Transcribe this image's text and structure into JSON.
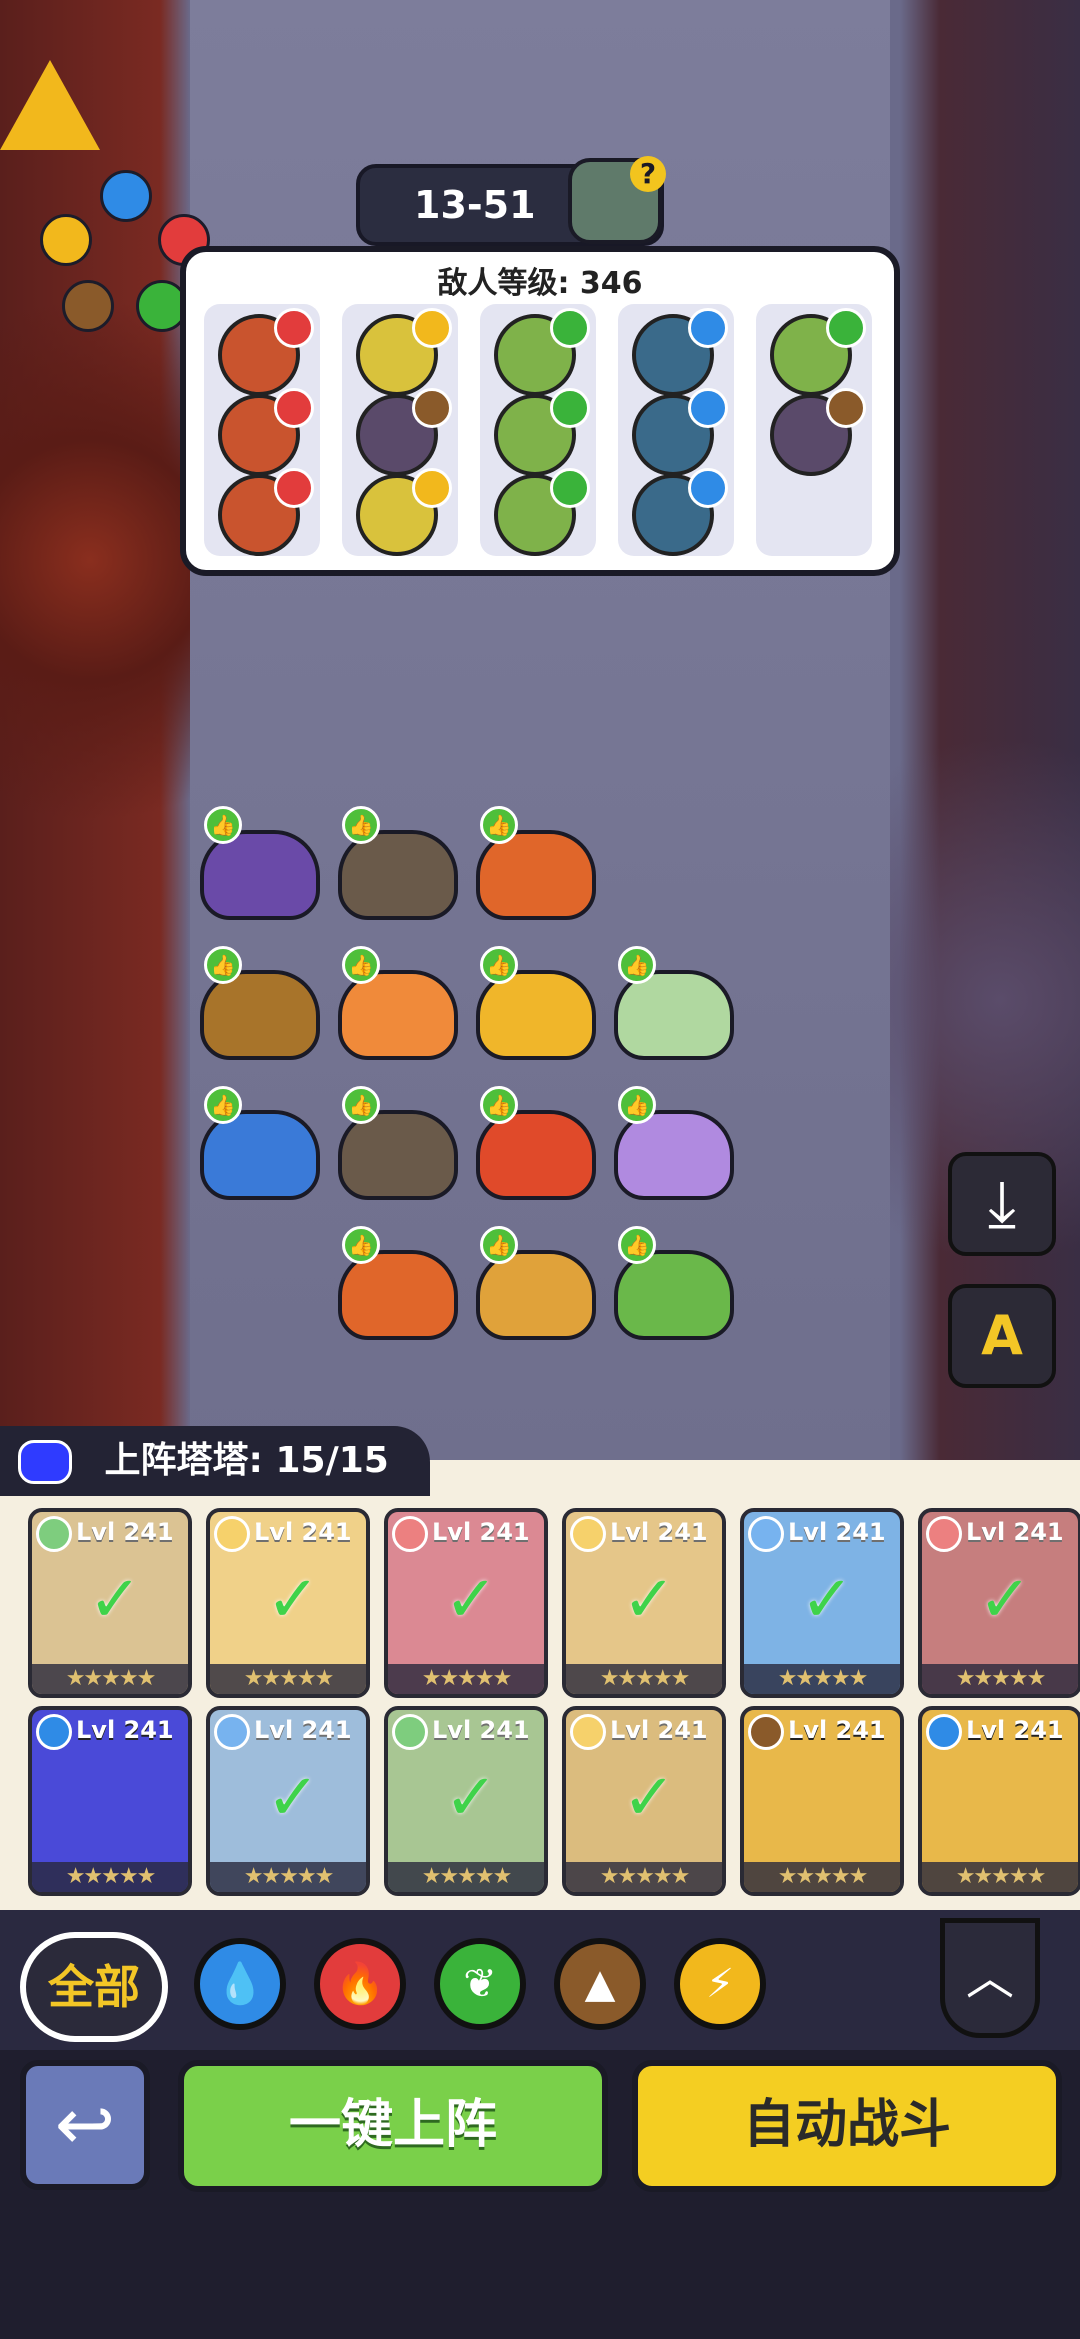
{
  "stage": {
    "label": "13-51"
  },
  "enemy_panel": {
    "title": "敌人等级: 346",
    "columns": [
      [
        "fire",
        "fire",
        "fire"
      ],
      [
        "light",
        "earth",
        "light"
      ],
      [
        "leaf",
        "leaf",
        "leaf"
      ],
      [
        "water",
        "water",
        "water"
      ],
      [
        "leaf",
        "earth"
      ]
    ]
  },
  "roster": {
    "title": "上阵塔塔: 15/15",
    "level_label": "Lvl 241",
    "stars": "★★★★★"
  },
  "filters": {
    "all_label": "全部",
    "elements": [
      "water",
      "fire",
      "leaf",
      "earth",
      "light"
    ]
  },
  "buttons": {
    "one_key_deploy": "一键上阵",
    "auto_battle": "自动战斗",
    "back_symbol": "↩",
    "collapse_symbol": "︿",
    "download_symbol": "⤓",
    "auto_settings_label": "A"
  },
  "colors": {
    "fire": "#e23c3c",
    "water": "#2f8be6",
    "leaf": "#3ab33a",
    "earth": "#8a5a2a",
    "light": "#f2b81c"
  }
}
